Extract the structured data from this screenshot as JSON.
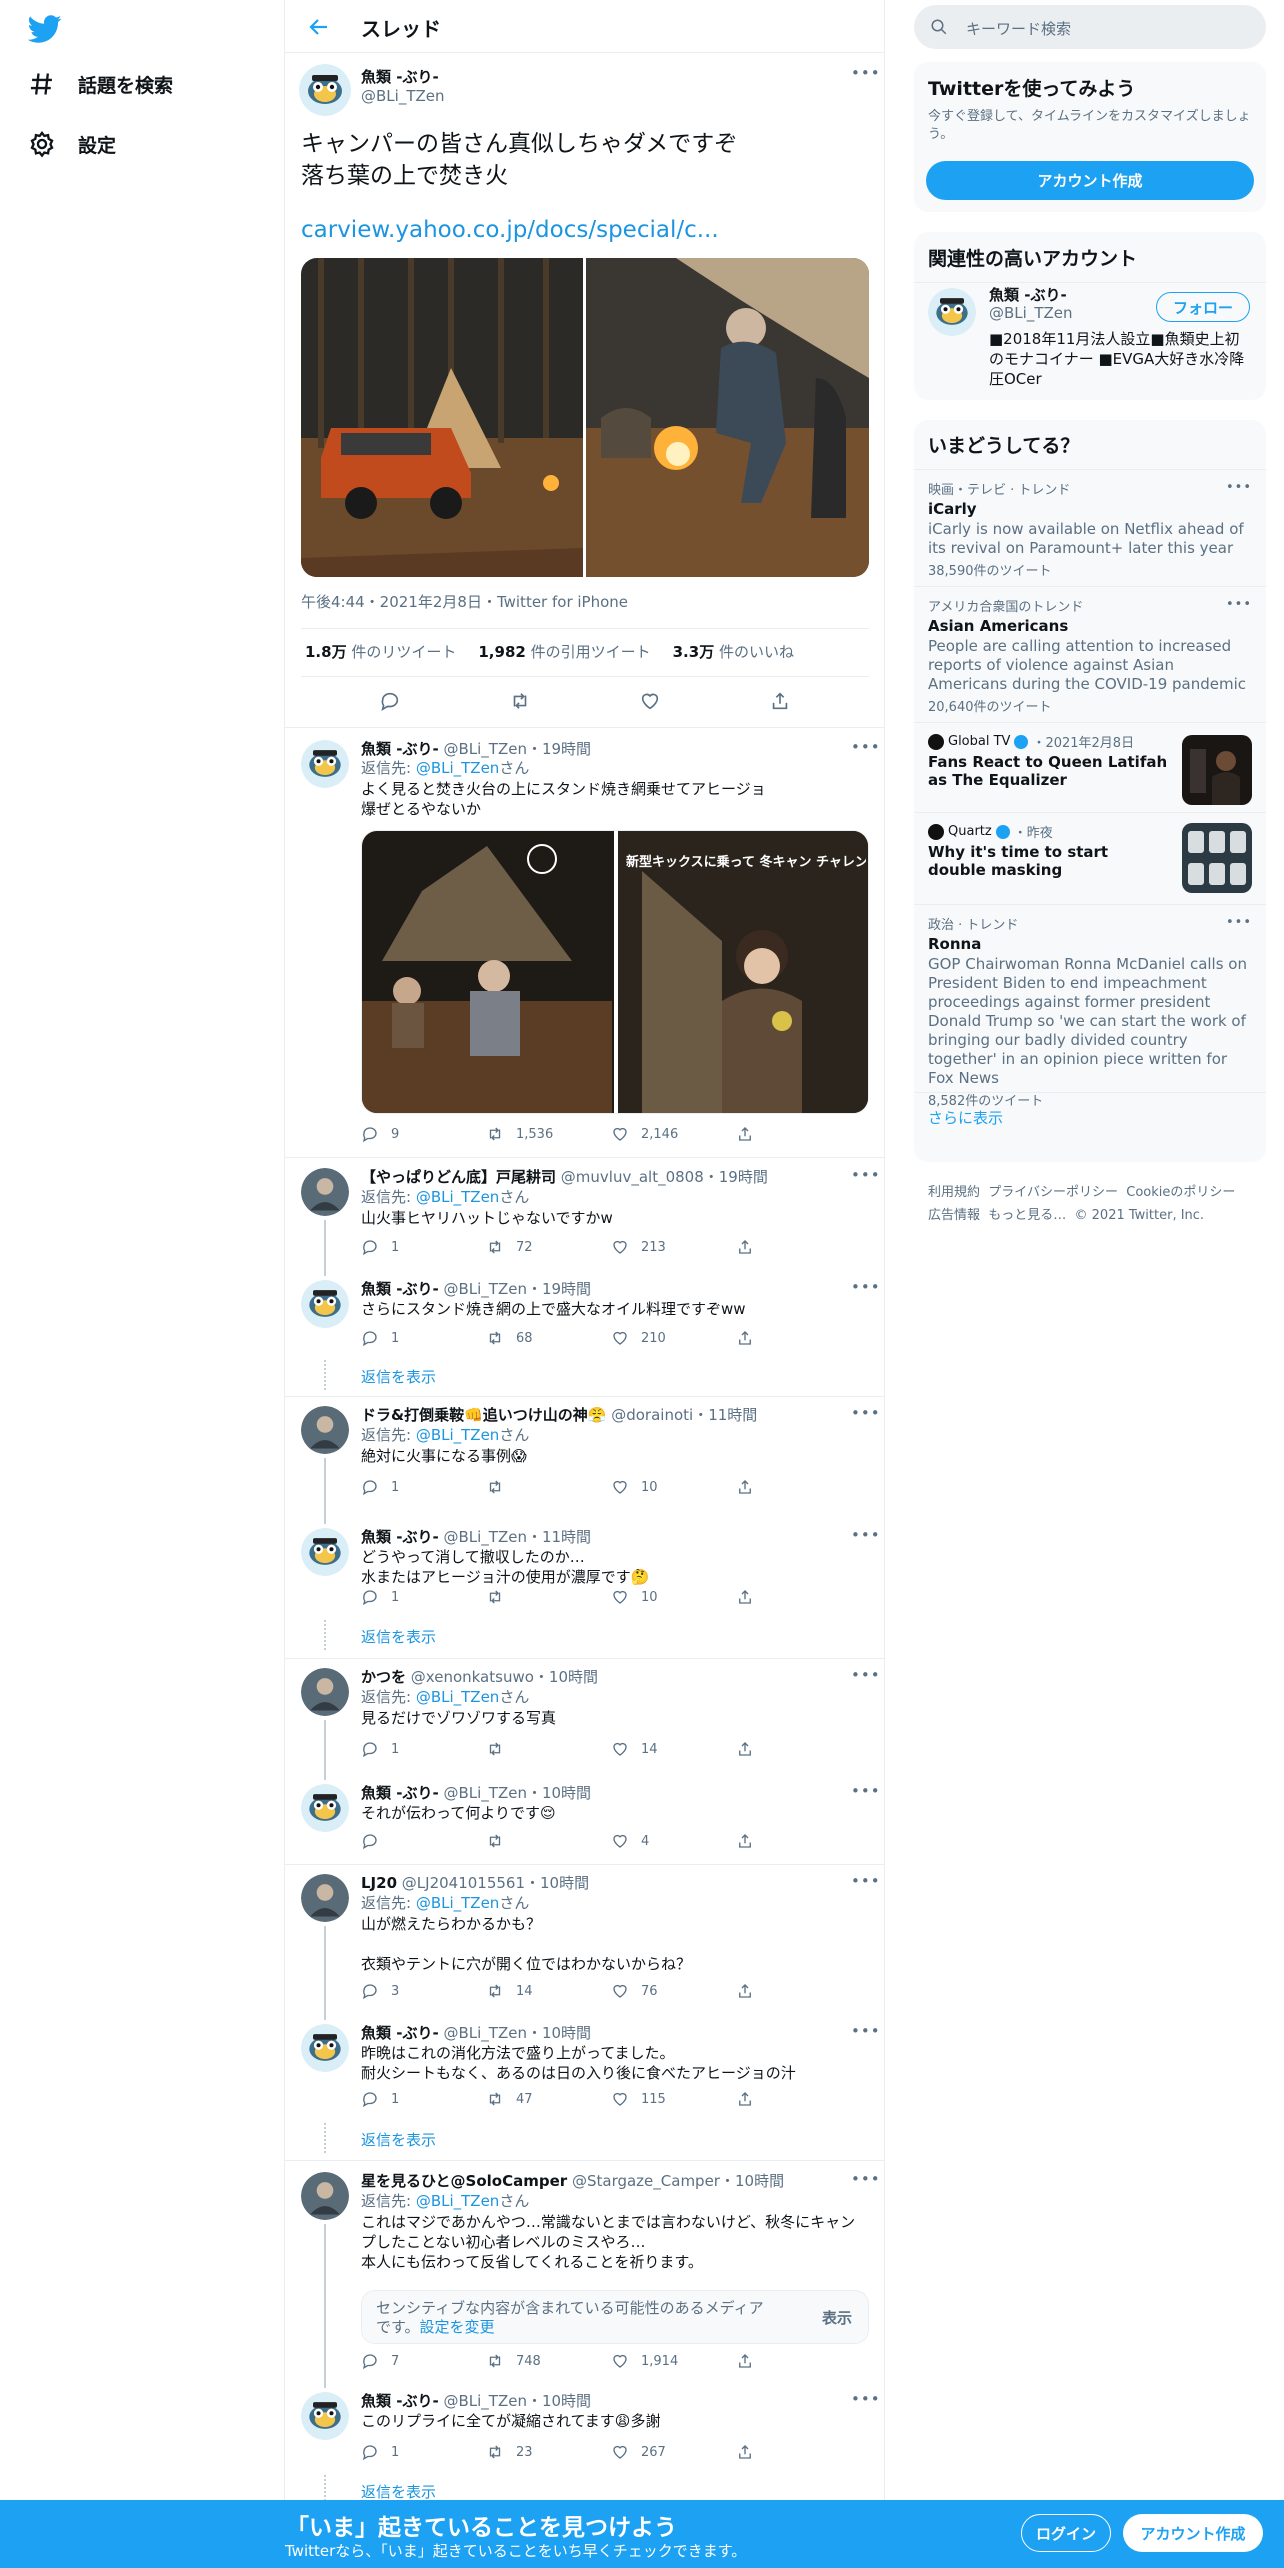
{
  "nav": {
    "explore": "話題を検索",
    "settings": "設定"
  },
  "header": {
    "title": "スレッド"
  },
  "main_tweet": {
    "name": "魚類 -ぶり-",
    "handle": "@BLi_TZen",
    "text": "キャンパーの皆さん真似しちゃダメですぞ\n落ち葉の上で焚き火",
    "link": "carview.yahoo.co.jp/docs/special/c...",
    "timestamp": "午後4:44・2021年2月8日・Twitter for iPhone",
    "retweets_num": "1.8万",
    "retweets_label": "件のリツイート",
    "quotes_num": "1,982",
    "quotes_label": "件の引用ツイート",
    "likes_num": "3.3万",
    "likes_label": "件のいいね"
  },
  "replies": [
    {
      "name": "魚類 -ぶり-",
      "handle": "@BLi_TZen",
      "time": "・19時間",
      "reply_prefix": "返信先: ",
      "reply_user": "@BLi_TZen",
      "reply_suffix": "さん",
      "text": "よく見ると焚き火台の上にスタンド焼き網乗せてアヒージョ\n爆ぜとるやないか",
      "video_caption": "新型キックスに乗って 冬キャン チャレンジ",
      "replies": "9",
      "retweets": "1,536",
      "likes": "2,146"
    },
    {
      "name": "【やっぱりどん底】戸尾耕司",
      "handle": "@muvluv_alt_0808",
      "time": "・19時間",
      "reply_prefix": "返信先: ",
      "reply_user": "@BLi_TZen",
      "reply_suffix": "さん",
      "text": "山火事ヒヤリハットじゃないですかw",
      "replies": "1",
      "retweets": "72",
      "likes": "213"
    },
    {
      "name": "魚類 -ぶり-",
      "handle": "@BLi_TZen",
      "time": "・19時間",
      "text": "さらにスタンド焼き網の上で盛大なオイル料理ですぞww",
      "replies": "1",
      "retweets": "68",
      "likes": "210",
      "show": "返信を表示"
    },
    {
      "name": "ドラ&打倒乗鞍👊追いつけ山の神😤",
      "handle": "@dorainoti",
      "time": "・11時間",
      "reply_prefix": "返信先: ",
      "reply_user": "@BLi_TZen",
      "reply_suffix": "さん",
      "text": "絶対に火事になる事例😱",
      "replies": "1",
      "retweets": "",
      "likes": "10"
    },
    {
      "name": "魚類 -ぶり-",
      "handle": "@BLi_TZen",
      "time": "・11時間",
      "text": "どうやって消して撤収したのか…\n水またはアヒージョ汁の使用が濃厚です🤔",
      "replies": "1",
      "retweets": "",
      "likes": "10",
      "show": "返信を表示"
    },
    {
      "name": "かつを",
      "handle": "@xenonkatsuwo",
      "time": "・10時間",
      "reply_prefix": "返信先: ",
      "reply_user": "@BLi_TZen",
      "reply_suffix": "さん",
      "text": "見るだけでゾワゾワする写真",
      "replies": "1",
      "retweets": "",
      "likes": "14"
    },
    {
      "name": "魚類 -ぶり-",
      "handle": "@BLi_TZen",
      "time": "・10時間",
      "text": "それが伝わって何よりです😌",
      "replies": "",
      "retweets": "",
      "likes": "4"
    },
    {
      "name": "LJ20",
      "handle": "@LJ2041015561",
      "time": "・10時間",
      "reply_prefix": "返信先: ",
      "reply_user": "@BLi_TZen",
      "reply_suffix": "さん",
      "text": "山が燃えたらわかるかも？\n\n衣類やテントに穴が開く位ではわかないからね？",
      "replies": "3",
      "retweets": "14",
      "likes": "76"
    },
    {
      "name": "魚類 -ぶり-",
      "handle": "@BLi_TZen",
      "time": "・10時間",
      "text": "昨晩はこれの消化方法で盛り上がってました。\n耐火シートもなく、あるのは日の入り後に食べたアヒージョの汁",
      "replies": "1",
      "retweets": "47",
      "likes": "115",
      "show": "返信を表示"
    },
    {
      "name": "星を見るひと@SoloCamper",
      "handle": "@Stargaze_Camper",
      "time": "・10時間",
      "reply_prefix": "返信先: ",
      "reply_user": "@BLi_TZen",
      "reply_suffix": "さん",
      "text": "これはマジであかんやつ…常識ないとまでは言わないけど、秋冬にキャンプしたことない初心者レベルのミスやろ…\n本人にも伝わって反省してくれることを祈ります。",
      "sensitive": "センシティブな内容が含まれている可能性のあるメディアです。",
      "sensitive_link": "設定を変更",
      "sensitive_btn": "表示",
      "replies": "7",
      "retweets": "748",
      "likes": "1,914"
    },
    {
      "name": "魚類 -ぶり-",
      "handle": "@BLi_TZen",
      "time": "・10時間",
      "text": "このリプライに全てが凝縮されてます😩多謝",
      "replies": "1",
      "retweets": "23",
      "likes": "267",
      "show": "返信を表示"
    }
  ],
  "sidebar": {
    "search_placeholder": "キーワード検索",
    "signup_title": "Twitterを使ってみよう",
    "signup_desc": "今すぐ登録して、タイムラインをカスタマイズしましょう。",
    "signup_btn": "アカウント作成",
    "related_title": "関連性の高いアカウント",
    "related_name": "魚類 -ぶり-",
    "related_handle": "@BLi_TZen",
    "follow_btn": "フォロー",
    "related_bio": "■2018年11月法人設立■魚類史上初のモナコイナー ■EVGA大好き水冷降圧OCer",
    "trends_title": "いまどうしてる？",
    "trends": [
      {
        "meta": "映画・テレビ · トレンド",
        "title": "iCarly",
        "desc": "iCarly is now available on Netflix ahead of its revival on Paramount+ later this year",
        "count": "38,590件のツイート"
      },
      {
        "meta": "アメリカ合衆国のトレンド",
        "title": "Asian Americans",
        "desc": "People are calling attention to increased reports of violence against Asian Americans during the COVID-19 pandemic",
        "count": "20,640件のツイート"
      },
      {
        "source": "Global TV",
        "date": "・2021年2月8日",
        "title": "Fans React to Queen Latifah as The Equalizer"
      },
      {
        "source": "Quartz",
        "date": "・昨夜",
        "title": "Why it's time to start double masking"
      },
      {
        "meta": "政治 · トレンド",
        "title": "Ronna",
        "desc": "GOP Chairwoman Ronna McDaniel calls on President Biden to end impeachment proceedings against former president Donald Trump so 'we can start the work of bringing our badly divided country together' in an opinion piece written for Fox News",
        "count": "8,582件のツイート"
      }
    ],
    "show_more": "さらに表示",
    "footer1": "利用規約  プライバシーポリシー  Cookieのポリシー",
    "footer2": "広告情報  もっと見る…  © 2021 Twitter, Inc."
  },
  "bottom": {
    "title": "「いま」起きていることを見つけよう",
    "subtitle": "Twitterなら、「いま」起きていることをいち早くチェックできます。",
    "login": "ログイン",
    "signup": "アカウント作成"
  },
  "colors": {
    "accent": "#1da1f2",
    "link": "#1b95e0",
    "muted": "#5b7083"
  }
}
